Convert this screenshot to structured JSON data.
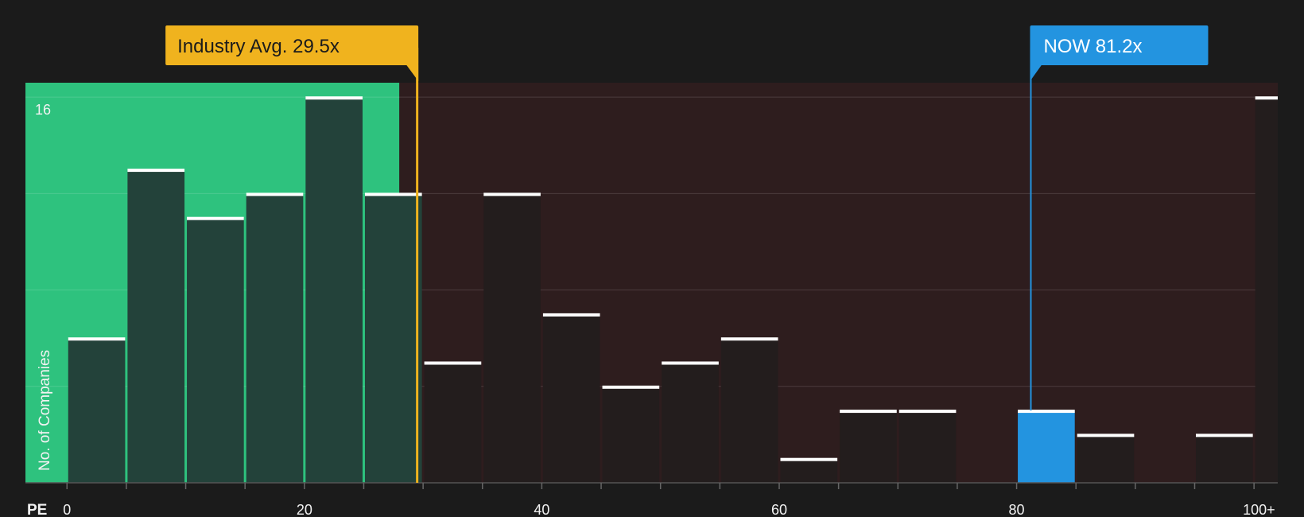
{
  "chart_data": {
    "type": "bar",
    "x_label": "PE",
    "y_label": "No. of Companies",
    "y_max_label": "16",
    "ylim": [
      0,
      16.6
    ],
    "xlim": [
      -3.5,
      102
    ],
    "bin_width": 5,
    "x_ticks": [
      {
        "value": 0,
        "label": "0"
      },
      {
        "value": 20,
        "label": "20"
      },
      {
        "value": 40,
        "label": "40"
      },
      {
        "value": 60,
        "label": "60"
      },
      {
        "value": 80,
        "label": "80"
      },
      {
        "value": 100,
        "label": "100+"
      }
    ],
    "bins": [
      {
        "start": 0,
        "count": 6
      },
      {
        "start": 5,
        "count": 13
      },
      {
        "start": 10,
        "count": 11
      },
      {
        "start": 15,
        "count": 12
      },
      {
        "start": 20,
        "count": 16
      },
      {
        "start": 25,
        "count": 12
      },
      {
        "start": 30,
        "count": 5
      },
      {
        "start": 35,
        "count": 12
      },
      {
        "start": 40,
        "count": 7
      },
      {
        "start": 45,
        "count": 4
      },
      {
        "start": 50,
        "count": 5
      },
      {
        "start": 55,
        "count": 6
      },
      {
        "start": 60,
        "count": 1
      },
      {
        "start": 65,
        "count": 3
      },
      {
        "start": 70,
        "count": 3
      },
      {
        "start": 75,
        "count": 0
      },
      {
        "start": 80,
        "count": 3,
        "highlight": true
      },
      {
        "start": 85,
        "count": 2
      },
      {
        "start": 90,
        "count": 0
      },
      {
        "start": 95,
        "count": 2
      },
      {
        "start": 100,
        "count": 16
      }
    ],
    "industry_avg": {
      "value": 29.5,
      "label": "Industry Avg. 29.5x"
    },
    "company": {
      "value": 81.2,
      "label": "NOW 81.2x"
    },
    "colors": {
      "background": "#1b1b1b",
      "green_zone": "#2ec27e",
      "red_zone": "#2e1d1e",
      "bar_in_green": "#23423a",
      "bar_in_red": "#231d1d",
      "bar_cap": "#ffffff",
      "highlight_bar": "#2394e0",
      "industry": "#f0b31e",
      "company": "#2394e0"
    }
  }
}
